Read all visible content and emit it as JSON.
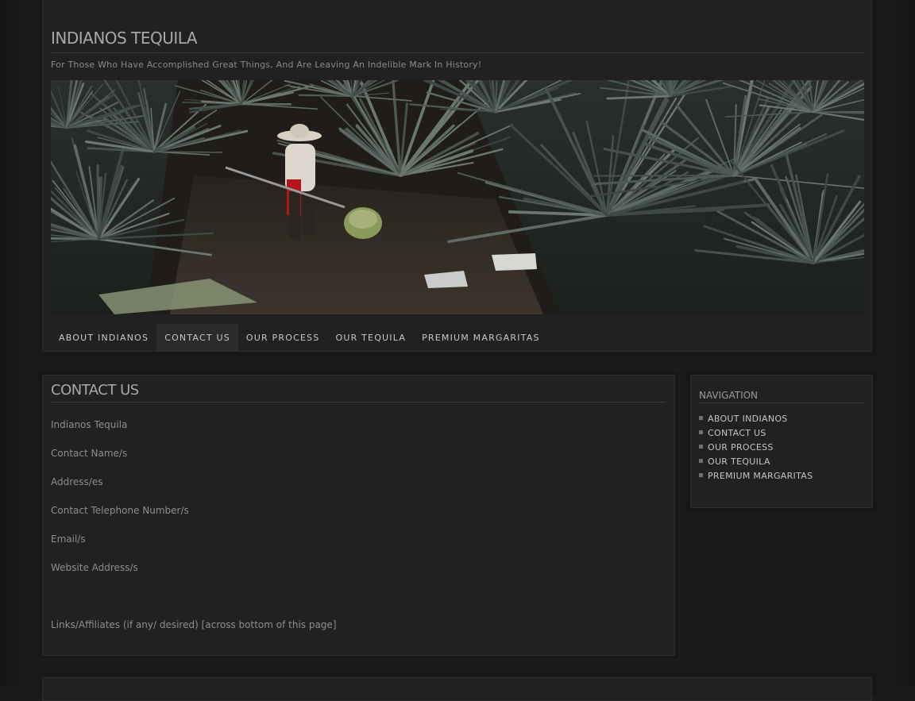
{
  "site": {
    "title": "INDIANOS TEQUILA",
    "tagline": "For Those Who Have Accomplished Great Things, And Are Leaving An Indelible Mark In History!"
  },
  "hero": {
    "description_icon": "agave-field-photo"
  },
  "nav": {
    "items": [
      {
        "label": "ABOUT INDIANOS",
        "active": false
      },
      {
        "label": "CONTACT US",
        "active": true
      },
      {
        "label": "OUR PROCESS",
        "active": false
      },
      {
        "label": "OUR TEQUILA",
        "active": false
      },
      {
        "label": "PREMIUM MARGARITAS",
        "active": false
      }
    ]
  },
  "content": {
    "title": "CONTACT US",
    "lines": [
      "Indianos Tequila",
      "Contact Name/s",
      "Address/es",
      "Contact Telephone Number/s",
      "Email/s",
      "Website Address/s",
      "Links/Affiliates (if any/ desired) [across bottom of this page]"
    ]
  },
  "sidebar": {
    "title": "NAVIGATION",
    "items": [
      {
        "label": "ABOUT INDIANOS"
      },
      {
        "label": "CONTACT US"
      },
      {
        "label": "OUR PROCESS"
      },
      {
        "label": "OUR TEQUILA"
      },
      {
        "label": "PREMIUM MARGARITAS"
      }
    ]
  },
  "colors": {
    "background": "#1b1b1b",
    "panel": "#212121",
    "text": "#8e8e8e",
    "nav_text": "#c8c8c8"
  }
}
